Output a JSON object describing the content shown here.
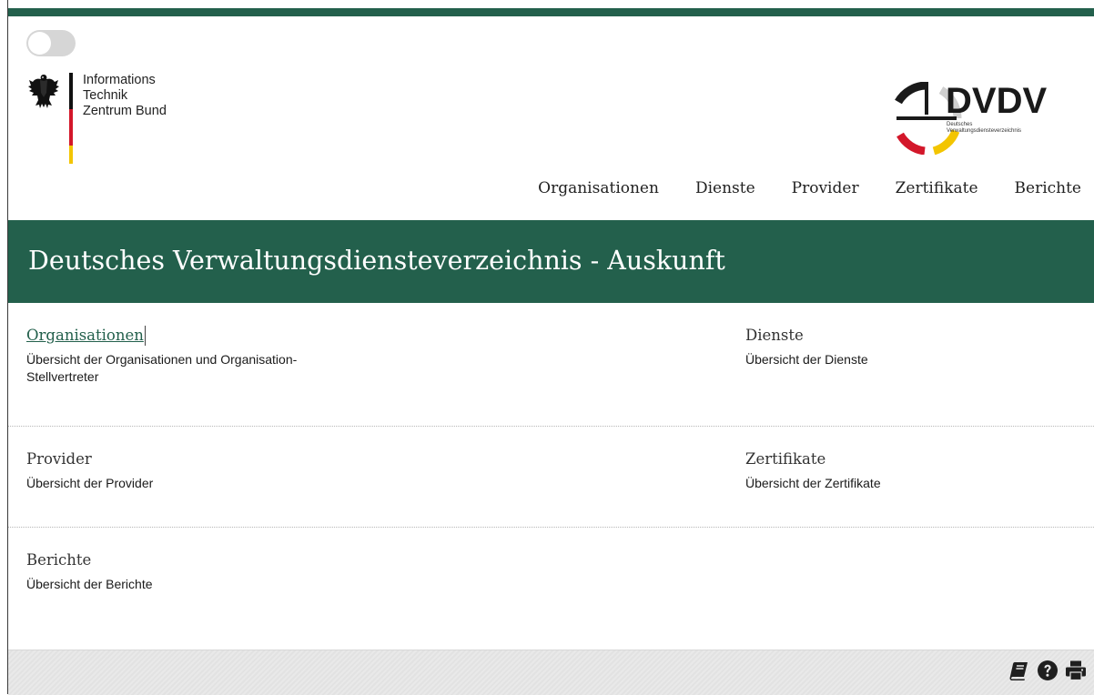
{
  "header": {
    "itzb_logo_lines": [
      "Informations",
      "Technik",
      "Zentrum Bund"
    ],
    "dvdv_logo_title": "DVDV",
    "dvdv_logo_sub_1": "Deutsches",
    "dvdv_logo_sub_2": "Verwaltungsdiensteverzeichnis",
    "toggle_icon": "toggle-switch-icon"
  },
  "nav": {
    "items": [
      {
        "label": "Organisationen"
      },
      {
        "label": "Dienste"
      },
      {
        "label": "Provider"
      },
      {
        "label": "Zertifikate"
      },
      {
        "label": "Berichte"
      }
    ]
  },
  "banner": {
    "title": "Deutsches Verwaltungsdiensteverzeichnis - Auskunft"
  },
  "sections": [
    {
      "title": "Organisationen",
      "desc": "Übersicht der Organisationen und Organisation-Stellvertreter"
    },
    {
      "title": "Dienste",
      "desc": "Übersicht der Dienste"
    },
    {
      "title": "Provider",
      "desc": "Übersicht der Provider"
    },
    {
      "title": "Zertifikate",
      "desc": "Übersicht der Zertifikate"
    },
    {
      "title": "Berichte",
      "desc": "Übersicht der Berichte"
    }
  ],
  "footer": {
    "icons": [
      "book-icon",
      "help-icon",
      "print-icon"
    ]
  },
  "colors": {
    "brand_green": "#23604c",
    "flag_black": "#111111",
    "flag_red": "#d3172a",
    "flag_gold": "#f3c500"
  }
}
